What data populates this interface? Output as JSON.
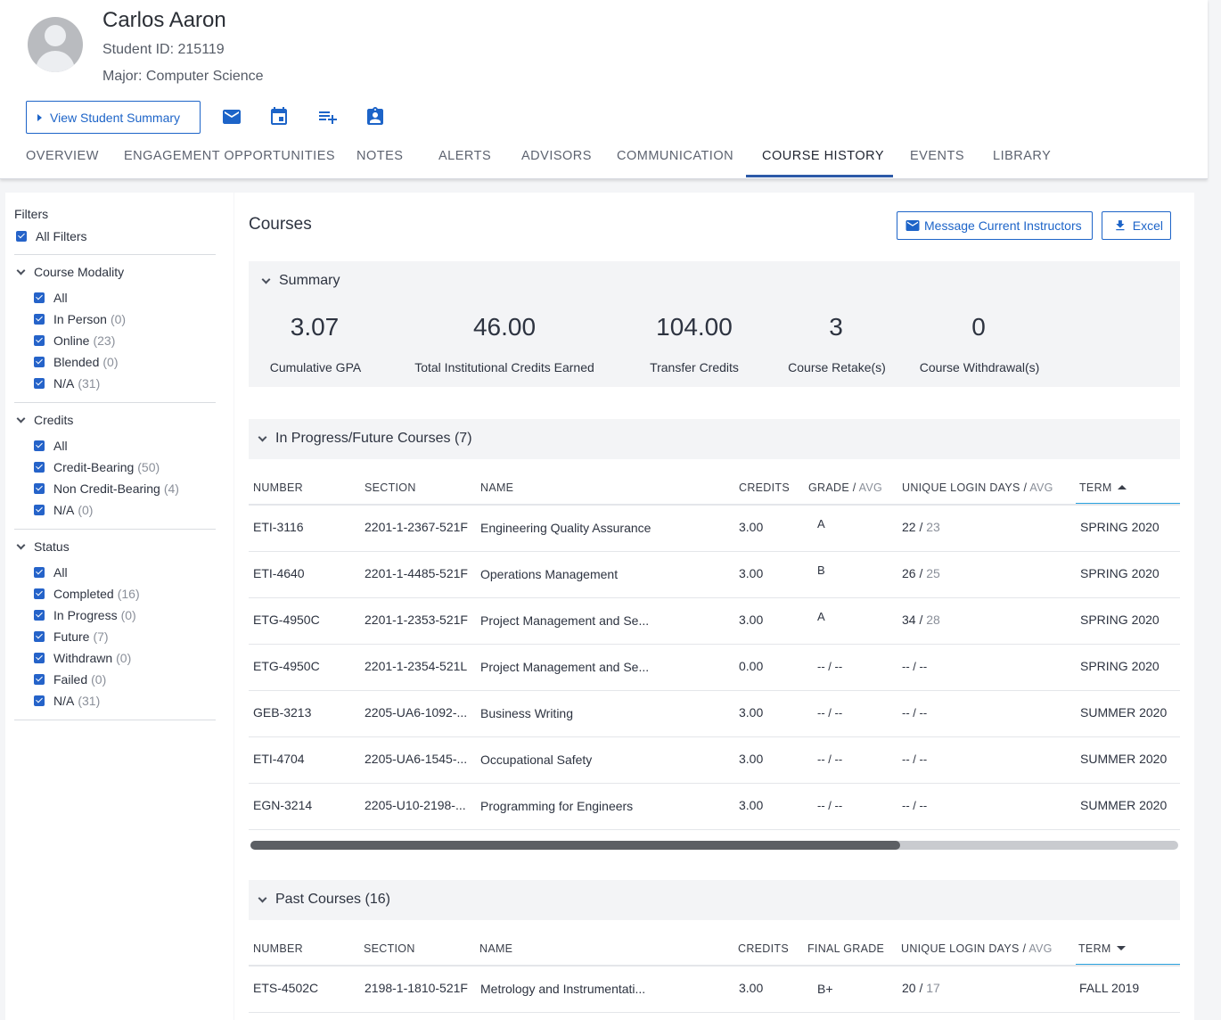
{
  "student": {
    "name": "Carlos Aaron",
    "id_text": "Student ID: 215119",
    "major_text": "Major: Computer Science",
    "summary_button": "View Student Summary"
  },
  "header_actions": [
    "mail-icon",
    "calendar-icon",
    "playlist-add-icon",
    "assignment-ind-icon"
  ],
  "tabs": [
    "OVERVIEW",
    "ENGAGEMENT OPPORTUNITIES",
    "NOTES",
    "ALERTS",
    "ADVISORS",
    "COMMUNICATION",
    "COURSE HISTORY",
    "EVENTS",
    "LIBRARY"
  ],
  "active_tab": "COURSE HISTORY",
  "filters": {
    "title": "Filters",
    "all_label": "All Filters",
    "groups": [
      {
        "title": "Course Modality",
        "items": [
          {
            "label": "All",
            "count": ""
          },
          {
            "label": "In Person",
            "count": "(0)"
          },
          {
            "label": "Online",
            "count": "(23)"
          },
          {
            "label": "Blended",
            "count": "(0)"
          },
          {
            "label": "N/A",
            "count": "(31)"
          }
        ]
      },
      {
        "title": "Credits",
        "items": [
          {
            "label": "All",
            "count": ""
          },
          {
            "label": "Credit-Bearing",
            "count": "(50)"
          },
          {
            "label": "Non Credit-Bearing",
            "count": "(4)"
          },
          {
            "label": "N/A",
            "count": "(0)"
          }
        ]
      },
      {
        "title": "Status",
        "items": [
          {
            "label": "All",
            "count": ""
          },
          {
            "label": "Completed",
            "count": "(16)"
          },
          {
            "label": "In Progress",
            "count": "(0)"
          },
          {
            "label": "Future",
            "count": "(7)"
          },
          {
            "label": "Withdrawn",
            "count": "(0)"
          },
          {
            "label": "Failed",
            "count": "(0)"
          },
          {
            "label": "N/A",
            "count": "(31)"
          }
        ]
      }
    ]
  },
  "courses": {
    "title": "Courses",
    "message_button": "Message Current Instructors",
    "excel_button": "Excel",
    "accent_color": "#1d64c8"
  },
  "summary": {
    "title": "Summary",
    "metrics": [
      {
        "value": "3.07",
        "label": "Cumulative GPA"
      },
      {
        "value": "46.00",
        "label": "Total Institutional Credits Earned"
      },
      {
        "value": "104.00",
        "label": "Transfer Credits"
      },
      {
        "value": "3",
        "label": "Course Retake(s)"
      },
      {
        "value": "0",
        "label": "Course Withdrawal(s)"
      }
    ]
  },
  "in_progress": {
    "title": "In Progress/Future Courses (7)",
    "headers": {
      "number": "NUMBER",
      "section": "SECTION",
      "name": "NAME",
      "credits": "CREDITS",
      "grade": "GRADE",
      "grade_avg": "AVG",
      "login": "UNIQUE LOGIN DAYS",
      "login_avg": "AVG",
      "term": "TERM",
      "sep": "/"
    },
    "rows": [
      {
        "number": "ETI-3116",
        "section": "2201-1-2367-521F",
        "name": "Engineering Quality Assurance",
        "credits": "3.00",
        "grade": "A",
        "login": "22",
        "login_avg": "23",
        "term": "SPRING 2020"
      },
      {
        "number": "ETI-4640",
        "section": "2201-1-4485-521F",
        "name": "Operations Management",
        "credits": "3.00",
        "grade": "B",
        "login": "26",
        "login_avg": "25",
        "term": "SPRING 2020"
      },
      {
        "number": "ETG-4950C",
        "section": "2201-1-2353-521F",
        "name": "Project Management and Se...",
        "credits": "3.00",
        "grade": "A",
        "login": "34",
        "login_avg": "28",
        "term": "SPRING 2020"
      },
      {
        "number": "ETG-4950C",
        "section": "2201-1-2354-521L",
        "name": "Project Management and Se...",
        "credits": "0.00",
        "grade": "-- / --",
        "login": "-- / --",
        "login_avg": "",
        "term": "SPRING 2020"
      },
      {
        "number": "GEB-3213",
        "section": "2205-UA6-1092-...",
        "name": "Business Writing",
        "credits": "3.00",
        "grade": "-- / --",
        "login": "-- / --",
        "login_avg": "",
        "term": "SUMMER 2020"
      },
      {
        "number": "ETI-4704",
        "section": "2205-UA6-1545-...",
        "name": "Occupational Safety",
        "credits": "3.00",
        "grade": "-- / --",
        "login": "-- / --",
        "login_avg": "",
        "term": "SUMMER 2020"
      },
      {
        "number": "EGN-3214",
        "section": "2205-U10-2198-...",
        "name": "Programming for Engineers",
        "credits": "3.00",
        "grade": "-- / --",
        "login": "-- / --",
        "login_avg": "",
        "term": "SUMMER 2020"
      }
    ],
    "scroll_position": 0.7
  },
  "past": {
    "title": "Past Courses (16)",
    "headers": {
      "number": "NUMBER",
      "section": "SECTION",
      "name": "NAME",
      "credits": "CREDITS",
      "grade": "FINAL GRADE",
      "login": "UNIQUE LOGIN DAYS",
      "login_avg": "AVG",
      "term": "TERM",
      "sep": "/"
    },
    "rows": [
      {
        "number": "ETS-4502C",
        "section": "2198-1-1810-521F",
        "name": "Metrology and Instrumentati...",
        "credits": "3.00",
        "grade": "B+",
        "login": "20",
        "login_avg": "17",
        "term": "FALL 2019"
      }
    ]
  }
}
